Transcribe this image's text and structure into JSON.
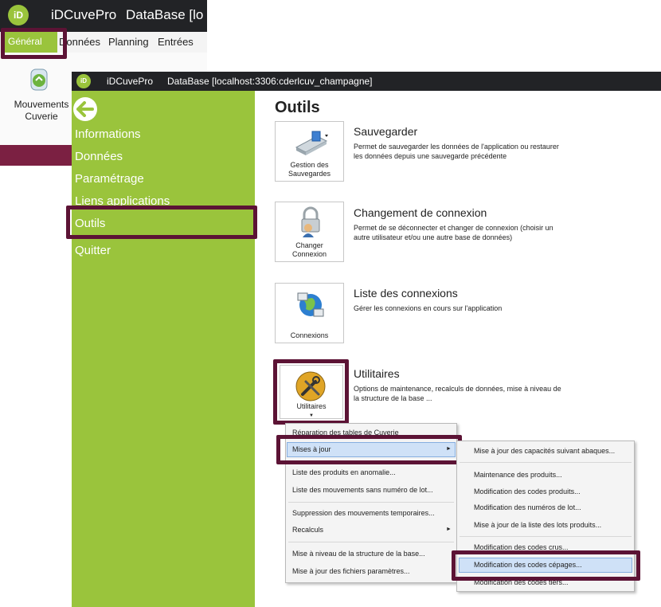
{
  "background_window": {
    "app_name": "iDCuvePro",
    "database_partial": "DataBase [lo",
    "logo_text": "iD",
    "tabs": [
      "Général",
      "Données",
      "Planning",
      "Entrées"
    ],
    "ribbon_item_label_line1": "Mouvements",
    "ribbon_item_label_line2": "Cuverie"
  },
  "main_window": {
    "logo_text": "iD",
    "app_name": "iDCuvePro",
    "database": "DataBase [localhost:3306:cderlcuv_champagne]"
  },
  "sidebar": {
    "items": [
      "Informations",
      "Données",
      "Paramétrage",
      "Liens applications",
      "Outils",
      "Quitter"
    ],
    "active_item": "Outils"
  },
  "content": {
    "title": "Outils",
    "tools": [
      {
        "button_label_line1": "Gestion des",
        "button_label_line2": "Sauvegardes",
        "title": "Sauvegarder",
        "description": "Permet de sauvegarder les données de l'application ou restaurer les données depuis une sauvegarde précédente"
      },
      {
        "button_label_line1": "Changer",
        "button_label_line2": "Connexion",
        "title": "Changement de connexion",
        "description": "Permet de se déconnecter et changer de connexion (choisir un autre utilisateur et/ou une autre base de données)"
      },
      {
        "button_label_line1": "Connexions",
        "button_label_line2": "",
        "title": "Liste des connexions",
        "description": "Gérer les connexions en cours sur l'application"
      },
      {
        "button_label_line1": "Utilitaires",
        "button_label_line2": "",
        "title": "Utilitaires",
        "description": "Options de maintenance, recalculs de données, mise à niveau de la structure de la base ..."
      }
    ]
  },
  "utilities_menu": {
    "items": [
      "Réparation des tables de Cuverie",
      "Mises à jour",
      "Liste des produits en anomalie...",
      "Liste des mouvements sans numéro de lot...",
      "Suppression des mouvements temporaires...",
      "Recalculs",
      "Mise à niveau de la structure de la base...",
      "Mise à jour des fichiers paramètres..."
    ],
    "selected": "Mises à jour"
  },
  "updates_submenu": {
    "items": [
      "Mise à jour des capacités suivant abaques...",
      "Maintenance des produits...",
      "Modification des codes produits...",
      "Modification des numéros de lot...",
      "Mise à jour de la liste des lots produits...",
      "Modification des codes crus...",
      "Modification des codes cépages...",
      "Modification des codes tiers..."
    ],
    "selected": "Modification des codes cépages..."
  },
  "colors": {
    "sidebar_green": "#9ac43c",
    "highlight_border": "#5c1335",
    "titlebar": "#222326",
    "menu_selection": "#cfe1f7"
  }
}
